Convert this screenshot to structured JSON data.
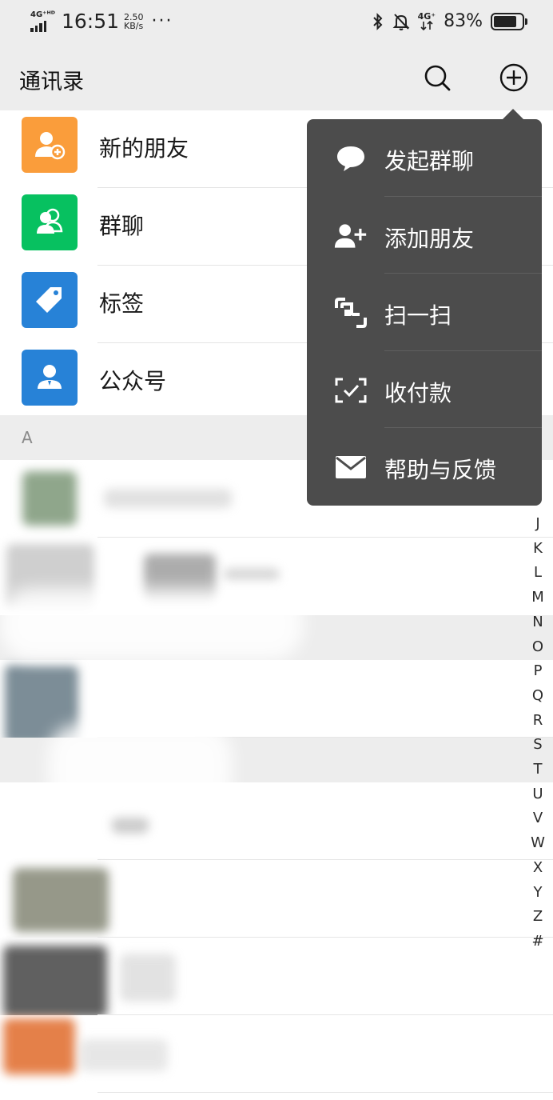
{
  "status_bar": {
    "network_left": "4G⁺ᴴᴰ",
    "time": "16:51",
    "speed_value": "2.50",
    "speed_unit": "KB/s",
    "more": "···",
    "network_right": "4G⁺",
    "battery_percent": "83%",
    "battery_level": 0.83
  },
  "header": {
    "title": "通讯录",
    "search_icon": "search-icon",
    "add_icon": "plus-circle-icon"
  },
  "functions": [
    {
      "label": "新的朋友",
      "icon": "add-friend-icon",
      "color": "#fa9d3b"
    },
    {
      "label": "群聊",
      "icon": "group-icon",
      "color": "#07c160"
    },
    {
      "label": "标签",
      "icon": "tag-icon",
      "color": "#2782d7"
    },
    {
      "label": "公众号",
      "icon": "official-account-icon",
      "color": "#2782d7"
    }
  ],
  "section_header": "A",
  "index_letters": [
    "J",
    "K",
    "L",
    "M",
    "N",
    "O",
    "P",
    "Q",
    "R",
    "S",
    "T",
    "U",
    "V",
    "W",
    "X",
    "Y",
    "Z",
    "#"
  ],
  "popup_menu": [
    {
      "label": "发起群聊",
      "icon": "chat-bubble-icon"
    },
    {
      "label": "添加朋友",
      "icon": "add-user-icon"
    },
    {
      "label": "扫一扫",
      "icon": "scan-icon"
    },
    {
      "label": "收付款",
      "icon": "payment-scan-icon"
    },
    {
      "label": "帮助与反馈",
      "icon": "mail-icon"
    }
  ],
  "colors": {
    "background": "#ededed",
    "popup": "#4c4c4c"
  }
}
